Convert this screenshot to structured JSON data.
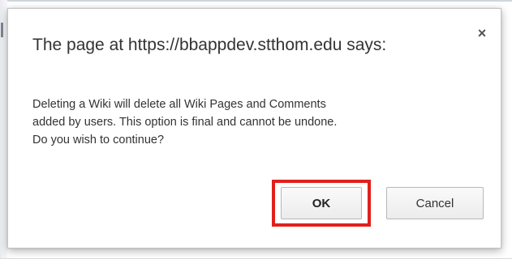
{
  "dialog": {
    "title": "The page at https://bbappdev.stthom.edu says:",
    "close_icon": "×",
    "message_lines": [
      "Deleting a Wiki will delete all Wiki Pages and Comments",
      "added by users. This option is final and cannot be undone.",
      "Do you wish to continue?"
    ],
    "ok_label": "OK",
    "cancel_label": "Cancel"
  },
  "icons": {
    "close": "close-icon"
  },
  "colors": {
    "highlight": "#e0201c",
    "text": "#333333",
    "dialog_border": "#c6c6c6"
  }
}
